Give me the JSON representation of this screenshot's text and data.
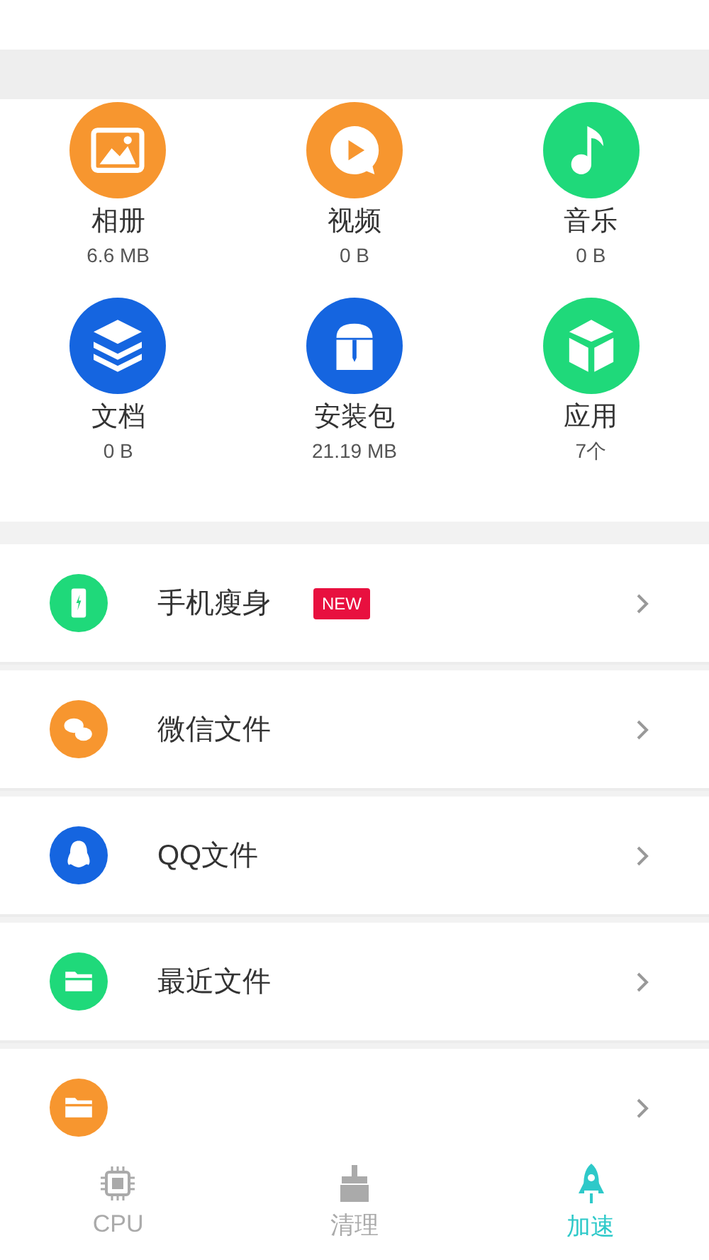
{
  "categories": [
    {
      "kind": "photos",
      "color": "#f7962f",
      "label": "相册",
      "size": "6.6 MB"
    },
    {
      "kind": "video",
      "color": "#f7962f",
      "label": "视频",
      "size": "0 B"
    },
    {
      "kind": "music",
      "color": "#1fd97a",
      "label": "音乐",
      "size": "0 B"
    },
    {
      "kind": "documents",
      "color": "#1565e0",
      "label": "文档",
      "size": "0 B"
    },
    {
      "kind": "packages",
      "color": "#1565e0",
      "label": "安装包",
      "size": "21.19 MB"
    },
    {
      "kind": "apps",
      "color": "#1fd97a",
      "label": "应用",
      "size": "7个"
    }
  ],
  "tools": [
    {
      "kind": "phone",
      "color": "#1fd97a",
      "label": "手机瘦身",
      "badge": "NEW"
    },
    {
      "kind": "chat",
      "color": "#f7962f",
      "label": "微信文件"
    },
    {
      "kind": "penguin",
      "color": "#1565e0",
      "label": "QQ文件"
    },
    {
      "kind": "folder",
      "color": "#1fd97a",
      "label": "最近文件"
    },
    {
      "kind": "folder",
      "color": "#f7962f"
    }
  ],
  "tabs": [
    {
      "kind": "chip",
      "label": "CPU",
      "selected": false
    },
    {
      "kind": "broom",
      "label": "清理",
      "selected": false
    },
    {
      "kind": "rocket",
      "label": "加速",
      "selected": true
    }
  ]
}
